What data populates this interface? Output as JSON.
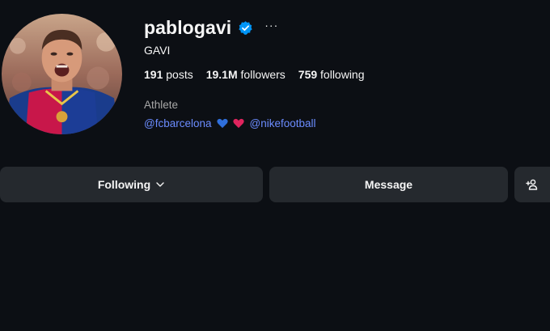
{
  "profile": {
    "username": "pablogavi",
    "full_name": "GAVI",
    "category": "Athlete",
    "verified": true,
    "more_label": "···",
    "stats": {
      "posts_count": "191",
      "posts_label": "posts",
      "followers_count": "19.1M",
      "followers_label": "followers",
      "following_count": "759",
      "following_label": "following"
    },
    "links": {
      "mention_1": "@fcbarcelona",
      "mention_2": "@nikefootball"
    },
    "icons": {
      "verified": "verified-badge-icon",
      "more": "more-options-icon",
      "emoji_1": "blue-heart-icon",
      "emoji_2": "red-heart-icon"
    }
  },
  "actions": {
    "following_label": "Following",
    "message_label": "Message",
    "following_icon": "chevron-down-icon",
    "suggest_icon": "add-user-icon"
  },
  "colors": {
    "background": "#0c0f14",
    "button": "#25292e",
    "link": "#6b8cff",
    "verified": "#0095f6",
    "muted": "#a8a8a8"
  }
}
